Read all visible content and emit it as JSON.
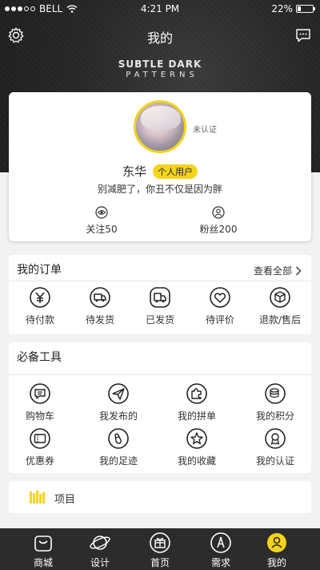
{
  "status_bar": {
    "carrier": "BELL",
    "time": "4:21 PM",
    "battery": "22%",
    "battery_level": 0.22
  },
  "nav": {
    "title": "我的",
    "settings_icon": "gear-icon",
    "message_icon": "message-icon"
  },
  "banner": {
    "line1": "SUBTLE DARK",
    "line2": "PATTERNS"
  },
  "profile": {
    "verify_status": "未认证",
    "name": "东华",
    "badge": "个人用户",
    "bio": "别减肥了，你丑不仅是因为胖",
    "stats": [
      {
        "label": "关注50",
        "icon": "eye-icon"
      },
      {
        "label": "粉丝200",
        "icon": "user-icon"
      }
    ]
  },
  "orders": {
    "title": "我的订单",
    "view_all": "查看全部",
    "items": [
      {
        "label": "待付款",
        "icon": "yen-icon"
      },
      {
        "label": "待发货",
        "icon": "van-icon"
      },
      {
        "label": "已发货",
        "icon": "truck-icon"
      },
      {
        "label": "待评价",
        "icon": "heart-icon"
      },
      {
        "label": "退款/售后",
        "icon": "box-icon"
      }
    ]
  },
  "tools": {
    "title": "必备工具",
    "items": [
      {
        "label": "购物车",
        "icon": "chat-list-icon"
      },
      {
        "label": "我发布的",
        "icon": "paper-plane-icon"
      },
      {
        "label": "我的拼单",
        "icon": "puzzle-icon"
      },
      {
        "label": "我的积分",
        "icon": "coins-icon"
      },
      {
        "label": "优惠券",
        "icon": "coupon-icon"
      },
      {
        "label": "我的足迹",
        "icon": "footprint-icon"
      },
      {
        "label": "我的收藏",
        "icon": "star-icon"
      },
      {
        "label": "我的认证",
        "icon": "medal-icon"
      }
    ]
  },
  "project": {
    "label": "项目",
    "icon": "books-icon"
  },
  "tabbar": {
    "items": [
      {
        "label": "商城",
        "icon": "shop-icon",
        "active": false
      },
      {
        "label": "设计",
        "icon": "planet-icon",
        "active": false
      },
      {
        "label": "首页",
        "icon": "gift-icon",
        "active": false
      },
      {
        "label": "需求",
        "icon": "compass-icon",
        "active": false
      },
      {
        "label": "我的",
        "icon": "user-icon",
        "active": true
      }
    ]
  },
  "colors": {
    "accent": "#f5d31c",
    "header_bg": "#262626",
    "tabbar_bg": "#2c2c2c"
  }
}
